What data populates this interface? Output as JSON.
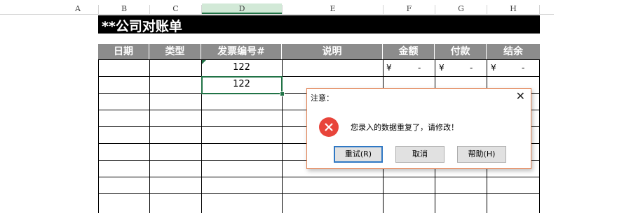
{
  "columns": [
    "A",
    "B",
    "C",
    "D",
    "E",
    "F",
    "G",
    "H"
  ],
  "title": "**公司对账单",
  "table": {
    "headers": [
      "日期",
      "类型",
      "发票编号#",
      "说明",
      "金额",
      "付款",
      "结余"
    ],
    "row1_invoice": "122",
    "row2_invoice": "122",
    "currency": "¥",
    "dash": "-"
  },
  "dialog": {
    "title": "注意：",
    "close": "✕",
    "message": "您录入的数据重复了，请修改！",
    "buttons": {
      "retry": "重试(R)",
      "cancel": "取消",
      "help": "帮助(H)"
    }
  }
}
